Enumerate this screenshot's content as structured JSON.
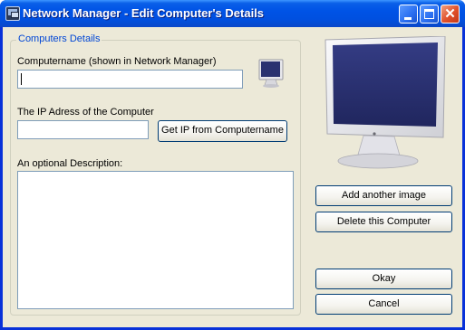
{
  "window": {
    "title": "Network Manager - Edit Computer's Details",
    "close_glyph": "✕"
  },
  "group": {
    "legend": "Computers Details",
    "computername_label": "Computername (shown in Network Manager)",
    "computername_value": "",
    "ip_label": "The IP Adress of the Computer",
    "ip_value": "",
    "get_ip_button": "Get IP from Computername",
    "description_label": "An optional Description:",
    "description_value": ""
  },
  "side": {
    "add_image_button": "Add another image",
    "delete_button": "Delete this Computer",
    "okay_button": "Okay",
    "cancel_button": "Cancel"
  },
  "icons": {
    "app": "network-manager-icon",
    "small_monitor": "monitor-icon",
    "large_monitor": "monitor-image"
  },
  "colors": {
    "titlebar": "#0053e6",
    "legend_text": "#0046d5",
    "client_bg": "#ece9d8",
    "monitor_screen": "#2a3270"
  }
}
